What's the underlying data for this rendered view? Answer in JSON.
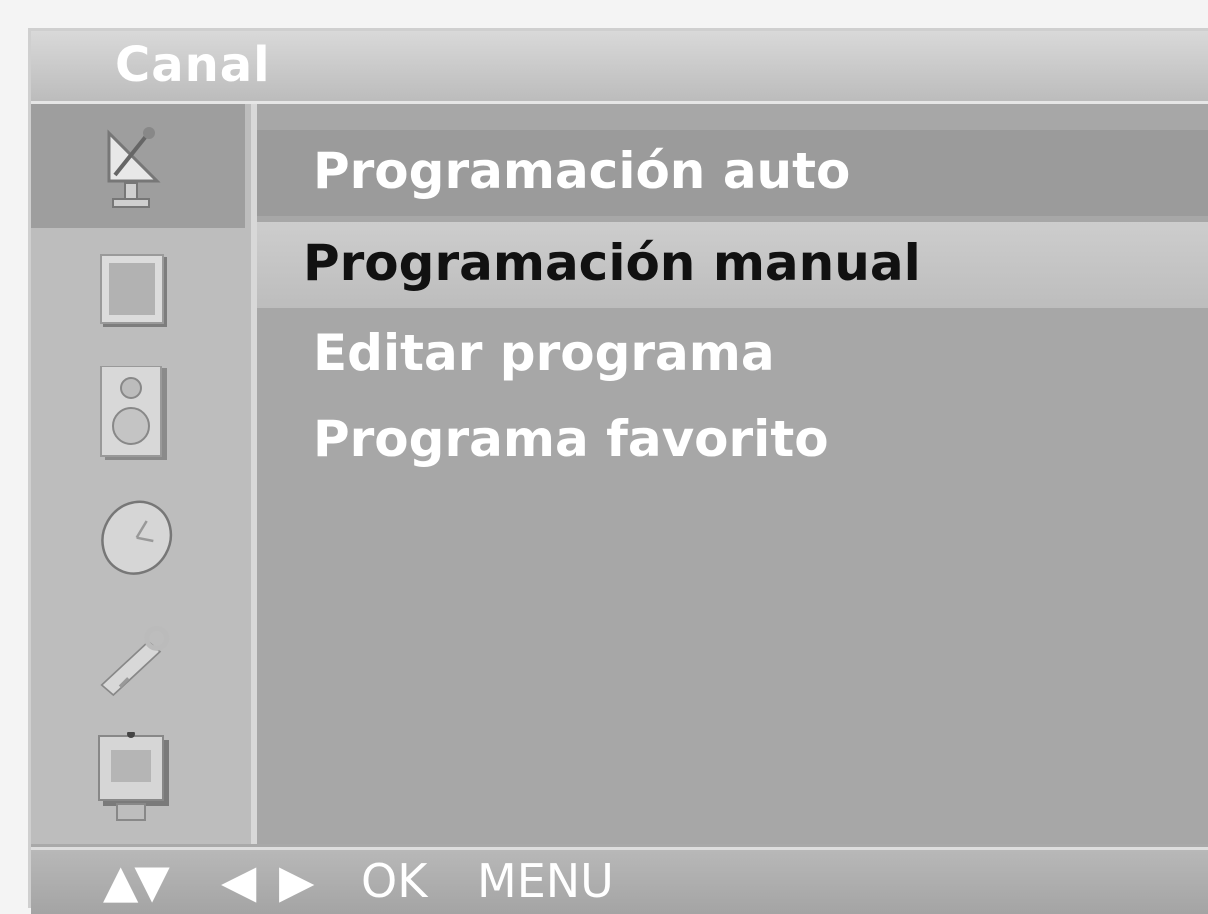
{
  "header": {
    "title": "Canal"
  },
  "sidebar": {
    "icons": [
      {
        "name": "satellite-dish-icon",
        "active": true
      },
      {
        "name": "picture-icon"
      },
      {
        "name": "speaker-icon"
      },
      {
        "name": "clock-icon"
      },
      {
        "name": "tools-icon"
      },
      {
        "name": "screen-icon"
      }
    ]
  },
  "menu": {
    "items": [
      {
        "label": "Programación auto"
      },
      {
        "label": "Programación manual"
      },
      {
        "label": "Editar programa"
      },
      {
        "label": "Programa favorito"
      }
    ],
    "selected_index": 1
  },
  "footer": {
    "updown": "▲▼",
    "leftright": "◀ ▶",
    "ok": "OK",
    "menu": "MENU"
  },
  "colors": {
    "panel": "#a7a7a7",
    "selected_row": "#c6c6c6",
    "text": "#ffffff",
    "selected_text": "#111111"
  }
}
